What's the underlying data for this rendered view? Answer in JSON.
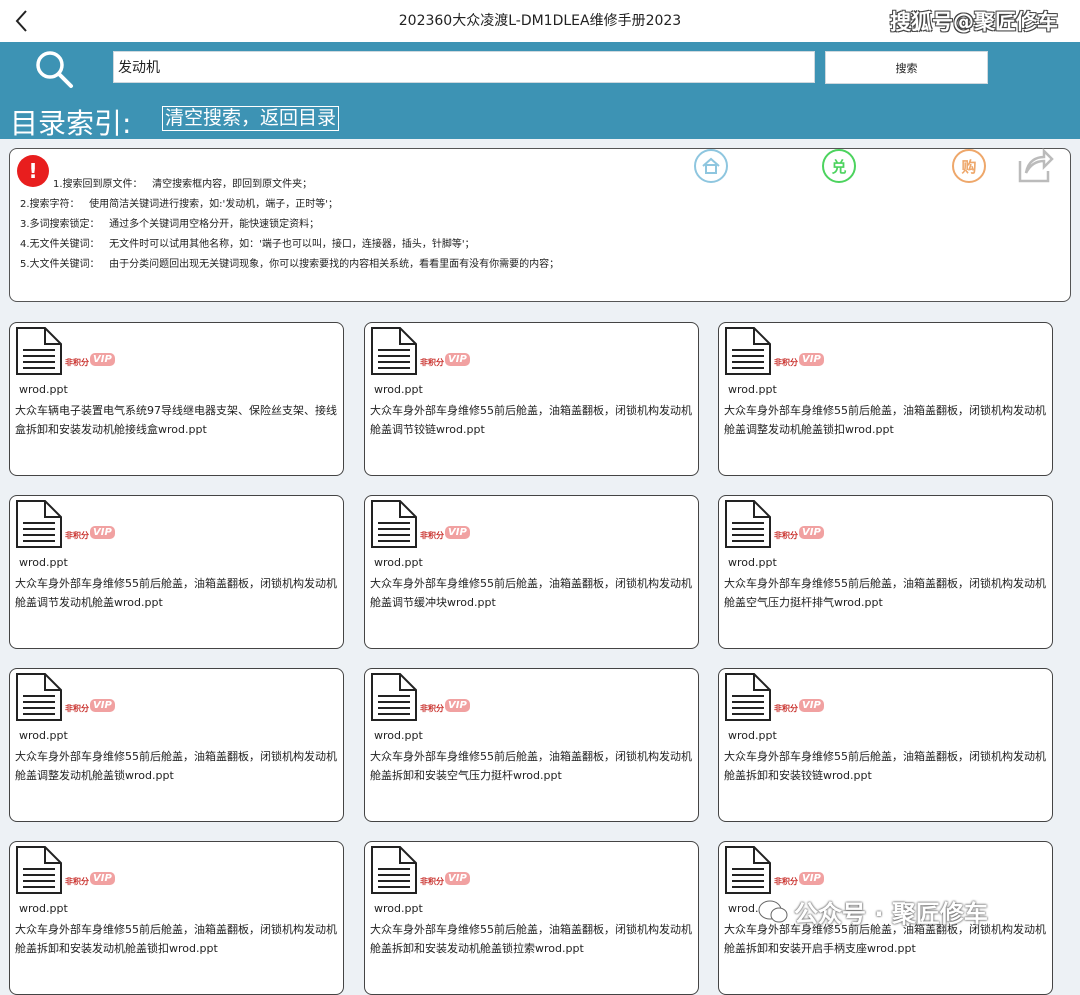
{
  "header": {
    "title": "202360大众凌渡L-DM1DLEA维修手册2023",
    "watermark": "搜狐号@聚匠修车"
  },
  "search": {
    "value": "发动机",
    "button_label": "搜索"
  },
  "catalog": {
    "label": "目录索引:",
    "clear_label": "清空搜索，返回目录"
  },
  "help": {
    "lines": [
      "1.搜索回到原文件：   清空搜索框内容，即回到原文件夹；",
      "2.搜索字符：   使用简洁关键词进行搜索，如:'发动机，端子，正时等'；",
      "3.多词搜索锁定：   通过多个关键词用空格分开，能快速锁定资料；",
      "4.无文件关键词：   无文件时可以试用其他名称，如：'端子也可以叫，接口，连接器，插头，针脚等'；",
      "5.大文件关键词：   由于分类问题回出现无关键词现象，你可以搜索要找的内容相关系统，看看里面有没有你需要的内容；"
    ],
    "icon_labels": {
      "home": "",
      "redeem": "兑",
      "buy": "购"
    }
  },
  "cards_common": {
    "nopoint_tag": "非积分",
    "vip_tag": "VIP"
  },
  "cards": [
    {
      "file": "wrod.ppt",
      "desc": "大众车辆电子装置电气系统97导线继电器支架、保险丝支架、接线盒拆卸和安装发动机舱接线盒wrod.ppt"
    },
    {
      "file": "wrod.ppt",
      "desc": "大众车身外部车身维修55前后舱盖，油箱盖翻板，闭锁机构发动机舱盖调节铰链wrod.ppt"
    },
    {
      "file": "wrod.ppt",
      "desc": "大众车身外部车身维修55前后舱盖，油箱盖翻板，闭锁机构发动机舱盖调整发动机舱盖锁扣wrod.ppt"
    },
    {
      "file": "wrod.ppt",
      "desc": "大众车身外部车身维修55前后舱盖，油箱盖翻板，闭锁机构发动机舱盖调节发动机舱盖wrod.ppt"
    },
    {
      "file": "wrod.ppt",
      "desc": "大众车身外部车身维修55前后舱盖，油箱盖翻板，闭锁机构发动机舱盖调节缓冲块wrod.ppt"
    },
    {
      "file": "wrod.ppt",
      "desc": "大众车身外部车身维修55前后舱盖，油箱盖翻板，闭锁机构发动机舱盖空气压力挺杆排气wrod.ppt"
    },
    {
      "file": "wrod.ppt",
      "desc": "大众车身外部车身维修55前后舱盖，油箱盖翻板，闭锁机构发动机舱盖调整发动机舱盖锁wrod.ppt"
    },
    {
      "file": "wrod.ppt",
      "desc": "大众车身外部车身维修55前后舱盖，油箱盖翻板，闭锁机构发动机舱盖拆卸和安装空气压力挺杆wrod.ppt"
    },
    {
      "file": "wrod.ppt",
      "desc": "大众车身外部车身维修55前后舱盖，油箱盖翻板，闭锁机构发动机舱盖拆卸和安装铰链wrod.ppt"
    },
    {
      "file": "wrod.ppt",
      "desc": "大众车身外部车身维修55前后舱盖，油箱盖翻板，闭锁机构发动机舱盖拆卸和安装发动机舱盖锁扣wrod.ppt"
    },
    {
      "file": "wrod.ppt",
      "desc": "大众车身外部车身维修55前后舱盖，油箱盖翻板，闭锁机构发动机舱盖拆卸和安装发动机舱盖锁拉索wrod.ppt"
    },
    {
      "file": "wrod.ppt",
      "desc": "大众车身外部车身维修55前后舱盖，油箱盖翻板，闭锁机构发动机舱盖拆卸和安装开启手柄支座wrod.ppt"
    }
  ],
  "bottom_watermark": "公众号 · 聚匠修车",
  "colors": {
    "accent": "#3d93b4",
    "alert": "#e81e1e",
    "home": "#8ec6df",
    "redeem": "#4cd35e",
    "buy": "#eea76a",
    "vip": "#f1a1a1"
  }
}
